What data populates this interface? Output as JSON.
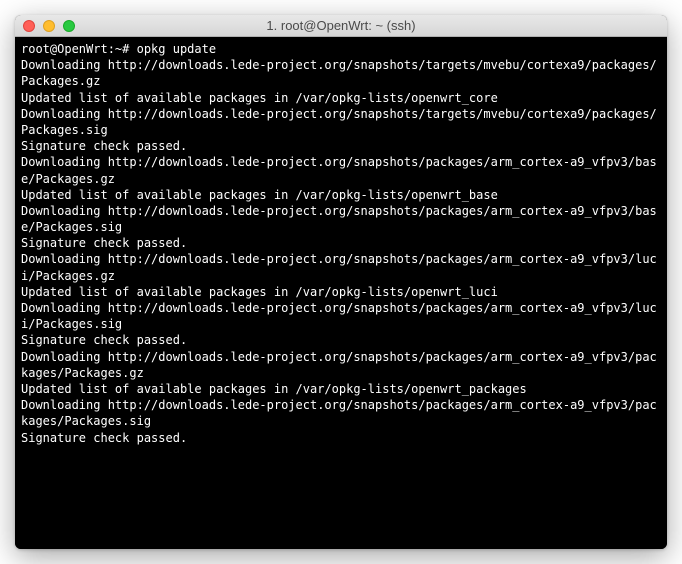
{
  "window": {
    "title": "1. root@OpenWrt: ~ (ssh)"
  },
  "terminal": {
    "prompt": "root@OpenWrt:~# ",
    "command": "opkg update",
    "lines": [
      "Downloading http://downloads.lede-project.org/snapshots/targets/mvebu/cortexa9/packages/Packages.gz",
      "Updated list of available packages in /var/opkg-lists/openwrt_core",
      "Downloading http://downloads.lede-project.org/snapshots/targets/mvebu/cortexa9/packages/Packages.sig",
      "Signature check passed.",
      "Downloading http://downloads.lede-project.org/snapshots/packages/arm_cortex-a9_vfpv3/base/Packages.gz",
      "Updated list of available packages in /var/opkg-lists/openwrt_base",
      "Downloading http://downloads.lede-project.org/snapshots/packages/arm_cortex-a9_vfpv3/base/Packages.sig",
      "Signature check passed.",
      "Downloading http://downloads.lede-project.org/snapshots/packages/arm_cortex-a9_vfpv3/luci/Packages.gz",
      "Updated list of available packages in /var/opkg-lists/openwrt_luci",
      "Downloading http://downloads.lede-project.org/snapshots/packages/arm_cortex-a9_vfpv3/luci/Packages.sig",
      "Signature check passed.",
      "Downloading http://downloads.lede-project.org/snapshots/packages/arm_cortex-a9_vfpv3/packages/Packages.gz",
      "Updated list of available packages in /var/opkg-lists/openwrt_packages",
      "Downloading http://downloads.lede-project.org/snapshots/packages/arm_cortex-a9_vfpv3/packages/Packages.sig",
      "Signature check passed."
    ]
  }
}
